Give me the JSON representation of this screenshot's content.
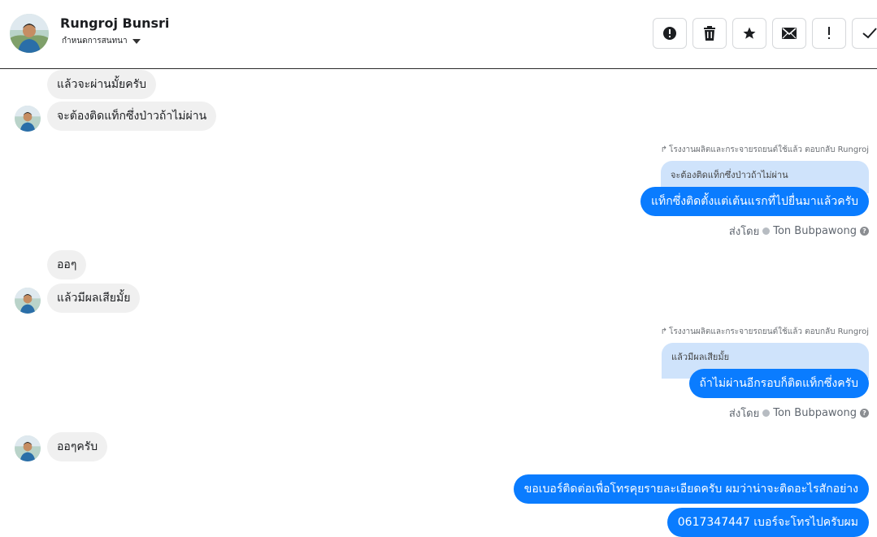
{
  "header": {
    "contact_name": "Rungroj Bunsri",
    "assign_label": "กำหนดการสนทนา",
    "toolbar": [
      {
        "name": "mark-spam-button",
        "icon": "alert-circle-icon"
      },
      {
        "name": "delete-button",
        "icon": "trash-icon"
      },
      {
        "name": "star-button",
        "icon": "star-icon"
      },
      {
        "name": "mark-unread-button",
        "icon": "envelope-icon"
      },
      {
        "name": "follow-up-button",
        "icon": "exclamation-icon"
      },
      {
        "name": "mark-done-button",
        "icon": "check-icon"
      }
    ]
  },
  "messages": {
    "m1": "แล้วจะผ่านมั้ยครับ",
    "m2": "จะต้องติดแท็กซึ่งป่าวถ้าไม่ผ่าน",
    "reply1": {
      "note": "โรงงานผลิตและกระจายรถยนต์ใช้แล้ว ตอบกลับ Rungroj",
      "quoted": "จะต้องติดแท็กซึ่งป่าวถ้าไม่ผ่าน",
      "text": "แท็กซึ่งติดตั้งแต่เต้นแรกที่ไปยื่นมาแล้วครับ",
      "sent_by_prefix": "ส่งโดย",
      "sent_by_name": "Ton Bubpawong"
    },
    "m3": "ออๆ",
    "m4": "แล้วมีผลเสียมั้ย",
    "reply2": {
      "note": "โรงงานผลิตและกระจายรถยนต์ใช้แล้ว ตอบกลับ Rungroj",
      "quoted": "แล้วมีผลเสียมั้ย",
      "text": "ถ้าไม่ผ่านอีกรอบก็ติดแท็กซึ่งครับ",
      "sent_by_prefix": "ส่งโดย",
      "sent_by_name": "Ton Bubpawong"
    },
    "m5": "ออๆครับ",
    "out1": "ขอเบอร์ติดต่อเพื่อโทรคุยรายละเอียดครับ ผมว่าน่าจะติดอะไรสักอย่าง",
    "out2": "0617347447 เบอร์จะโทรไปครับผม"
  },
  "colors": {
    "outgoing": "#0a7cff",
    "incoming": "#f0f0f0",
    "quoted": "#cfe3fb"
  }
}
